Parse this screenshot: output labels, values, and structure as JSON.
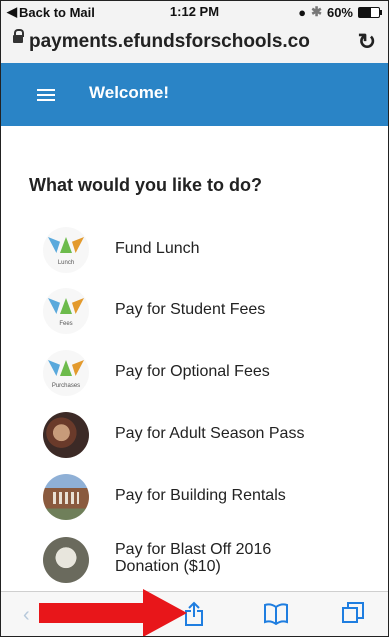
{
  "status_bar": {
    "back_label": "Back to Mail",
    "time": "1:12 PM",
    "battery": "60%"
  },
  "url_bar": {
    "url": "payments.efundsforschools.co"
  },
  "header": {
    "title": "Welcome!"
  },
  "main": {
    "question": "What would you like to do?",
    "items": [
      {
        "label": "Fund Lunch",
        "icon": "efunds-logo-icon",
        "icon_caption": "Lunch"
      },
      {
        "label": "Pay for Student Fees",
        "icon": "efunds-logo-icon",
        "icon_caption": "Fees"
      },
      {
        "label": "Pay for Optional Fees",
        "icon": "efunds-logo-icon",
        "icon_caption": "Purchases"
      },
      {
        "label": "Pay for Adult Season Pass",
        "icon": "student-photo-icon"
      },
      {
        "label": "Pay for Building Rentals",
        "icon": "building-photo-icon"
      },
      {
        "label_line1": "Pay for Blast Off 2016",
        "label_line2": "Donation ($10)",
        "icon": "sign-photo-icon"
      }
    ]
  },
  "toolbar": {
    "back_icon": "back-arrow-icon",
    "share_icon": "share-icon",
    "bookmarks_icon": "bookmarks-icon",
    "tabs_icon": "tabs-icon"
  },
  "annotation": {
    "arrow_color": "#e8161a",
    "points_to": "share-icon"
  },
  "colors": {
    "header_blue": "#2a84c6",
    "toolbar_blue": "#1f7ee0"
  }
}
